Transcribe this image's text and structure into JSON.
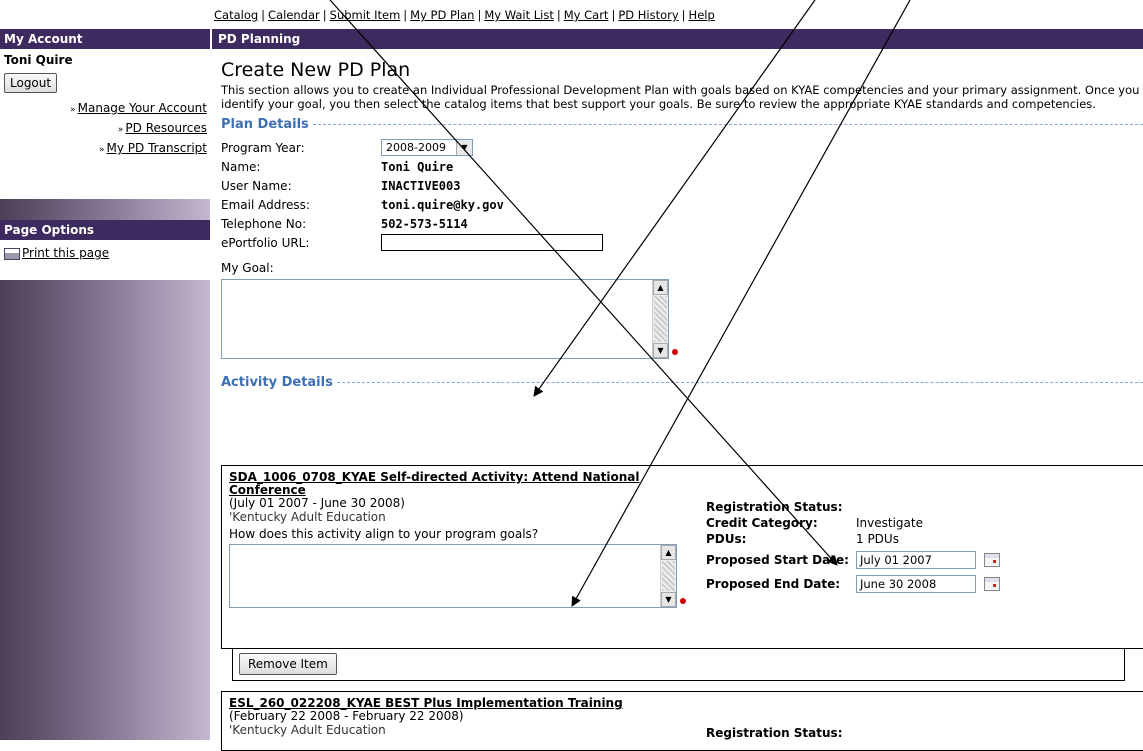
{
  "top_nav": {
    "items": [
      "Catalog",
      "Calendar",
      "Submit Item",
      "My PD Plan",
      "My Wait List",
      "My Cart",
      "PD History",
      "Help"
    ],
    "separator": "|"
  },
  "sidebar": {
    "my_account_header": "My Account",
    "user_name": "Toni Quire",
    "logout_label": "Logout",
    "links": [
      "Manage Your Account",
      "PD Resources",
      "My PD Transcript"
    ],
    "page_options_header": "Page Options",
    "print_label": "Print this page"
  },
  "main": {
    "header": "PD Planning",
    "title": "Create New PD Plan",
    "intro": "This section allows you to create an Individual Professional Development Plan with goals based on KYAE competencies and your primary assignment. Once you identify your goal, you then select the catalog items that best support your goals. Be sure to review the appropriate KYAE standards and competencies.",
    "plan_details_heading": "Plan Details",
    "fields": {
      "program_year_label": "Program Year:",
      "program_year_value": "2008-2009",
      "name_label": "Name:",
      "name_value": "Toni Quire",
      "username_label": "User Name:",
      "username_value": "INACTIVE003",
      "email_label": "Email Address:",
      "email_value": "toni.quire@ky.gov",
      "phone_label": "Telephone No:",
      "phone_value": "502-573-5114",
      "portfolio_label": "ePortfolio URL:",
      "portfolio_value": "",
      "goal_label": "My Goal:"
    },
    "activity_details_heading": "Activity Details",
    "activities": [
      {
        "title": "SDA_1006_0708_KYAE Self-directed Activity: Attend National Conference",
        "dates": "(July 01 2007 - June 30 2008)",
        "provider": "'Kentucky Adult Education",
        "question": "How does this activity align to your program goals?",
        "registration_status_label": "Registration Status:",
        "registration_status_value": "",
        "credit_category_label": "Credit Category:",
        "credit_category_value": "Investigate",
        "pdus_label": "PDUs:",
        "pdus_value": "1 PDUs",
        "start_label": "Proposed Start Date:",
        "start_value": "July 01 2007",
        "end_label": "Proposed End Date:",
        "end_value": "June 30 2008",
        "remove_label": "Remove Item"
      },
      {
        "title": "ESL_260_022208_KYAE BEST Plus Implementation Training",
        "dates": "(February 22 2008 - February 22 2008)",
        "provider": "'Kentucky Adult Education",
        "registration_status_label": "Registration Status:"
      }
    ]
  },
  "icons": {
    "program_year_dropdown": "chevron-down-icon",
    "print": "printer-icon",
    "calendar": "calendar-icon",
    "required": "required-dot-icon",
    "link_bullet": "double-arrow-icon"
  },
  "colors": {
    "header_bar": "#3d2a5e",
    "section_heading": "#3d6fb5",
    "required_dot": "#cc0000"
  }
}
